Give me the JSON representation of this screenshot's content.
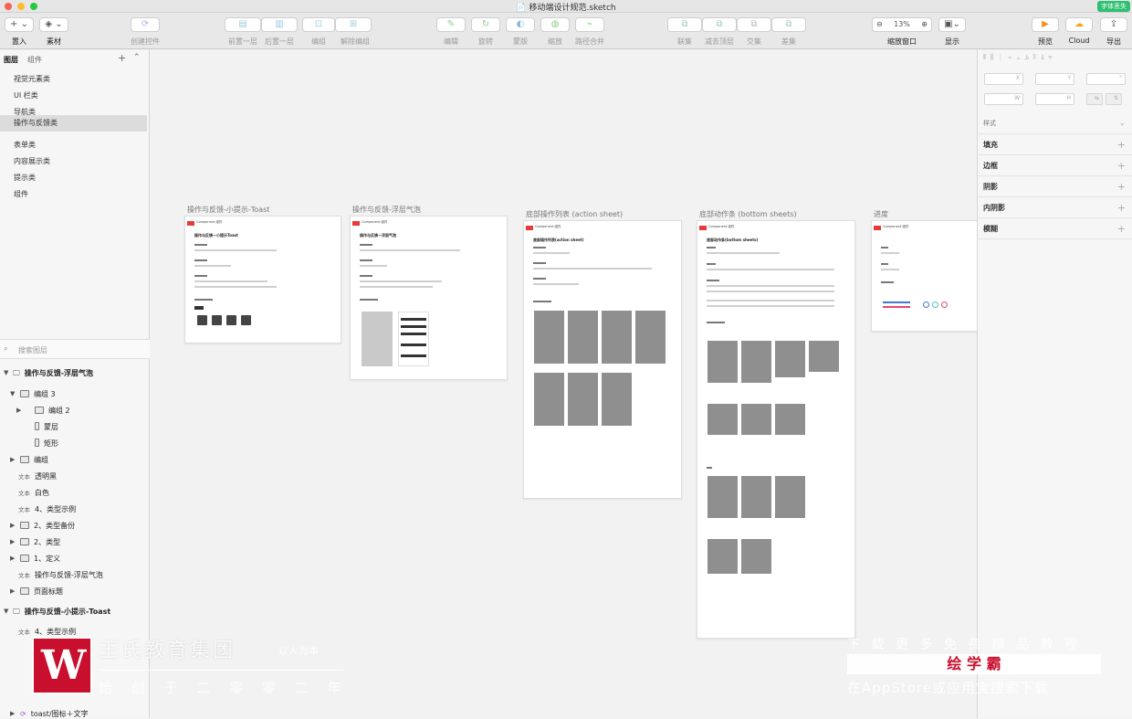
{
  "window": {
    "title": "移动端设计规范.sketch",
    "badge": "字体丢失"
  },
  "toolbar": {
    "insert_btn": "+ ⌄",
    "insert_label": "置入",
    "symbols_label": "素材",
    "create_symbol_label": "创建控件",
    "forward_label": "前置一层",
    "backward_label": "后置一层",
    "group_label": "编组",
    "ungroup_label": "解除编组",
    "edit_label": "编辑",
    "rotate_label": "旋转",
    "mask_label": "蒙版",
    "scale_label": "缩放",
    "flatten_label": "路径合并",
    "union_label": "联集",
    "subtract_label": "减去顶层",
    "intersect_label": "交集",
    "difference_label": "差集",
    "zoom_value": "13%",
    "zoom_label": "缩放窗口",
    "view_label": "显示",
    "preview_label": "预览",
    "cloud_label": "Cloud",
    "export_label": "导出"
  },
  "left_panel": {
    "tab_layers": "图层",
    "tab_components": "组件",
    "pages": [
      "视觉元素类",
      "UI 栏类",
      "导航类",
      "操作与反馈类",
      "表单类",
      "内容展示类",
      "提示类",
      "组件"
    ],
    "search_placeholder": "搜索图层",
    "layers": [
      {
        "label": "操作与反馈-浮层气泡",
        "kind": "artboard",
        "indent": 0,
        "expanded": true
      },
      {
        "label": "编组 3",
        "kind": "group",
        "indent": 1,
        "expanded": true
      },
      {
        "label": "编组 2",
        "kind": "group",
        "indent": 2,
        "expanded": false
      },
      {
        "label": "蒙层",
        "kind": "shape",
        "indent": 2
      },
      {
        "label": "矩形",
        "kind": "shape",
        "indent": 2
      },
      {
        "label": "编组",
        "kind": "group",
        "indent": 1,
        "expanded": false
      },
      {
        "label": "透明黑",
        "kind": "text",
        "indent": 1
      },
      {
        "label": "白色",
        "kind": "text",
        "indent": 1
      },
      {
        "label": "4、类型示例",
        "kind": "text",
        "indent": 1
      },
      {
        "label": "2、类型备份",
        "kind": "group",
        "indent": 1,
        "expanded": false
      },
      {
        "label": "2、类型",
        "kind": "group",
        "indent": 1,
        "expanded": false
      },
      {
        "label": "1、定义",
        "kind": "group",
        "indent": 1,
        "expanded": false
      },
      {
        "label": "操作与反馈-浮层气泡",
        "kind": "text",
        "indent": 1
      },
      {
        "label": "页面标题",
        "kind": "group",
        "indent": 1,
        "expanded": false
      },
      {
        "label": "操作与反馈-小提示-Toast",
        "kind": "artboard",
        "indent": 0,
        "expanded": true
      },
      {
        "label": "4、类型示例",
        "kind": "text",
        "indent": 1
      },
      {
        "label": "toast/图标＋文字",
        "kind": "symbol",
        "indent": 1
      }
    ],
    "text_tag": "文本"
  },
  "canvas": {
    "artboards": [
      {
        "title": "操作与反馈-小提示-Toast",
        "header": "操作与反馈—小提示Toast"
      },
      {
        "title": "操作与反馈-浮层气泡",
        "header": "操作与反馈—浮层气泡"
      },
      {
        "title": "底部操作列表 (action sheet)",
        "header": "底部操作列表(action sheet)"
      },
      {
        "title": "底部动作条 (bottom sheets)",
        "header": "底部动作条(bottom sheets)"
      },
      {
        "title": "进度",
        "header": ""
      }
    ],
    "component_label": "Component 组件"
  },
  "inspector": {
    "x_label": "X",
    "y_label": "Y",
    "w_label": "W",
    "h_label": "H",
    "style_label": "样式",
    "sections": [
      "填充",
      "边框",
      "阴影",
      "内阴影",
      "模糊"
    ]
  },
  "watermark": {
    "left_name": "王氏教育集团",
    "left_slogan": "以人为本",
    "left_sub": "始 创 于 二 零 零 二 年",
    "right_top": "下 载 更 多 免 费 精 品 教 程",
    "right_brand": "绘 学 霸",
    "right_bottom": "在AppStore或应用宝搜索下载"
  },
  "colors": {
    "accent_red": "#e83a3a",
    "badge_green": "#2fbf71",
    "cloud_orange": "#f4a21f",
    "preview_orange": "#f28f1a"
  }
}
